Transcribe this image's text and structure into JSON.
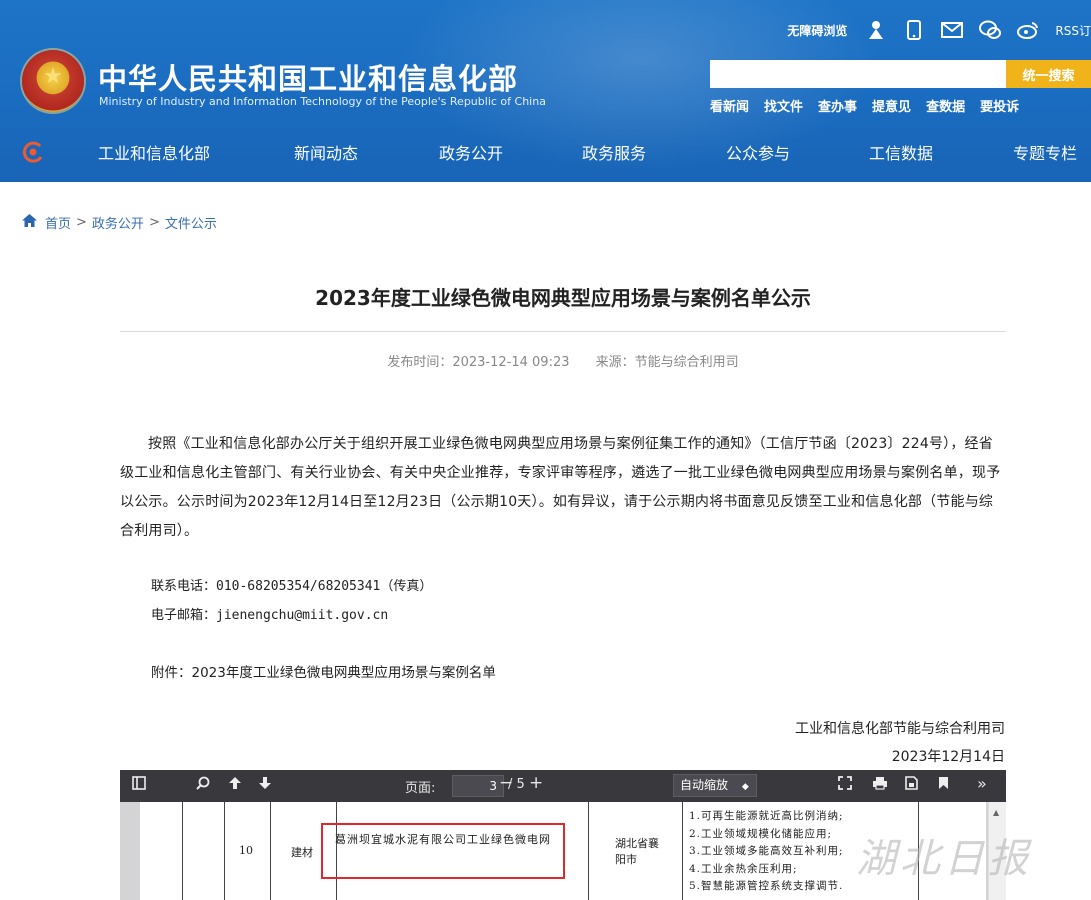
{
  "header": {
    "title_cn": "中华人民共和国工业和信息化部",
    "title_en": "Ministry of Industry and Information Technology of the People's Republic of China",
    "accessibility": "无障碍浏览",
    "rss": "RSS订",
    "search_placeholder": "",
    "search_button": "统一搜索",
    "quick_links": [
      "看新闻",
      "找文件",
      "查办事",
      "提意见",
      "查数据",
      "要投诉"
    ],
    "nav": [
      "工业和信息化部",
      "新闻动态",
      "政务公开",
      "政务服务",
      "公众参与",
      "工信数据",
      "专题专栏"
    ]
  },
  "breadcrumb": [
    "首页",
    "政务公开",
    "文件公示"
  ],
  "article": {
    "title": "2023年度工业绿色微电网典型应用场景与案例名单公示",
    "publish_time": "发布时间：2023-12-14 09:23",
    "source": "来源：节能与综合利用司",
    "body": "按照《工业和信息化部办公厅关于组织开展工业绿色微电网典型应用场景与案例征集工作的通知》（工信厅节函〔2023〕224号），经省级工业和信息化主管部门、有关行业协会、有关中央企业推荐，专家评审等程序，遴选了一批工业绿色微电网典型应用场景与案例名单，现予以公示。公示时间为2023年12月14日至12月23日（公示期10天）。如有异议，请于公示期内将书面意见反馈至工业和信息化部（节能与综合利用司）。",
    "phone": "联系电话：010-68205354/68205341（传真）",
    "email": "电子邮箱：jienengchu@miit.gov.cn",
    "attachment": "附件：2023年度工业绿色微电网典型应用场景与案例名单",
    "sign_org": "工业和信息化部节能与综合利用司",
    "sign_date": "2023年12月14日"
  },
  "pdf": {
    "page_label": "页面:",
    "current_page": "3",
    "total_pages": "/ 5",
    "zoom": "自动缩放",
    "row": {
      "index": "10",
      "industry": "建材",
      "case_name": "葛洲坝宜城水泥有限公司工业绿色微电网",
      "location": "湖北省襄阳市",
      "scenarios": [
        "1.可再生能源就近高比例消纳;",
        "2.工业领域规模化储能应用;",
        "3.工业领域多能高效互补利用;",
        "4.工业余热余压利用;",
        "5.智慧能源管控系统支撑调节."
      ]
    }
  },
  "watermark": "湖北日报"
}
